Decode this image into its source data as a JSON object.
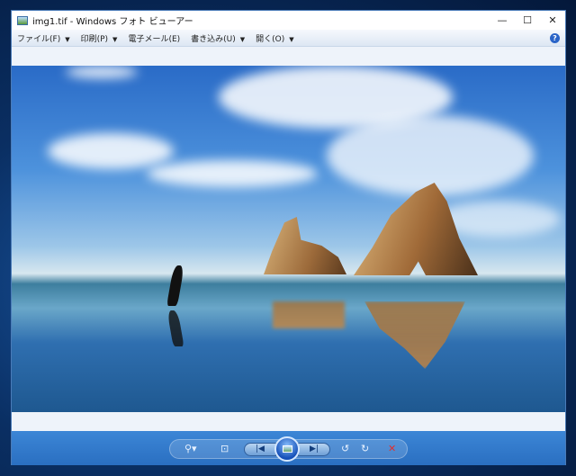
{
  "window": {
    "title": "img1.tif - Windows フォト ビューアー",
    "minimize": "—",
    "maximize": "☐",
    "close": "✕"
  },
  "menu": [
    {
      "label": "ファイル(F)",
      "has_dropdown": true
    },
    {
      "label": "印刷(P)",
      "has_dropdown": true
    },
    {
      "label": "電子メール(E)",
      "has_dropdown": false
    },
    {
      "label": "書き込み(U)",
      "has_dropdown": true
    },
    {
      "label": "開く(O)",
      "has_dropdown": true
    }
  ],
  "menu_arrow": "▼",
  "help": "?",
  "toolbar": {
    "zoom": "⚲▾",
    "fit": "⊡",
    "prev": "|◀",
    "next": "▶|",
    "rotate_ccw": "↺",
    "rotate_cw": "↻",
    "delete": "✕"
  },
  "colors": {
    "toolbar": "#2a6fc1",
    "delete": "#e03030"
  }
}
